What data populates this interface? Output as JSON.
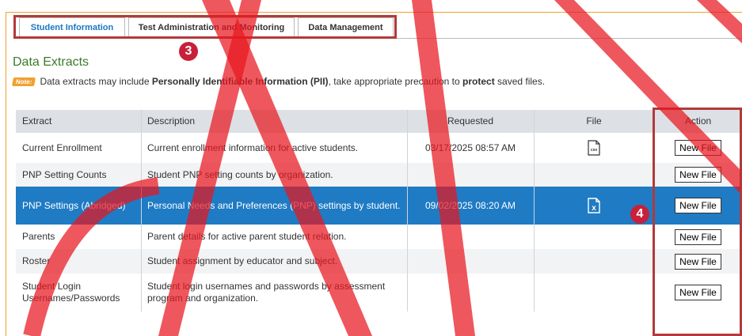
{
  "tabs": [
    {
      "label": "Student Information",
      "active": true
    },
    {
      "label": "Test Administration and Monitoring",
      "active": false
    },
    {
      "label": "Data Management",
      "active": false
    }
  ],
  "callouts": {
    "tabs_number": "3",
    "row_number": "4"
  },
  "section_title": "Data Extracts",
  "note": {
    "tag": "Note:",
    "text_1": "Data extracts may include ",
    "bold_1": "Personally Identifiable Information (PII)",
    "text_2": ", take appropriate precaution to ",
    "bold_2": "protect",
    "text_3": " saved files."
  },
  "table": {
    "headers": {
      "extract": "Extract",
      "description": "Description",
      "requested": "Requested",
      "file": "File",
      "action": "Action"
    },
    "rows": [
      {
        "extract": "Current Enrollment",
        "description": "Current enrollment information for active students.",
        "requested": "03/17/2025 08:57 AM",
        "file_icon": "csv-file-icon",
        "file_label": "csv",
        "action": "New File"
      },
      {
        "extract": "PNP Setting Counts",
        "description": "Student PNP setting counts by organization.",
        "requested": "",
        "file_icon": "",
        "file_label": "",
        "action": "New File"
      },
      {
        "extract": "PNP Settings (Abridged)",
        "description": "Personal Needs and Preferences (PNP) settings by student.",
        "requested": "09/02/2025 08:20 AM",
        "file_icon": "excel-file-icon",
        "file_label": "x",
        "action": "New File"
      },
      {
        "extract": "Parents",
        "description": "Parent details for active parent student relation.",
        "requested": "",
        "file_icon": "",
        "file_label": "",
        "action": "New File"
      },
      {
        "extract": "Roster",
        "description": "Student assignment by educator and subject.",
        "requested": "",
        "file_icon": "",
        "file_label": "",
        "action": "New File"
      },
      {
        "extract": "Student Login Usernames/Passwords",
        "description": "Student login usernames and passwords by assessment program and organization.",
        "requested": "",
        "file_icon": "",
        "file_label": "",
        "action": "New File"
      }
    ]
  },
  "colors": {
    "accent_blue": "#1f7bc4",
    "highlight_red": "#b23a3a",
    "title_green": "#3c7a2a",
    "note_orange": "#f0a030",
    "watermark_red": "#e8161e"
  }
}
